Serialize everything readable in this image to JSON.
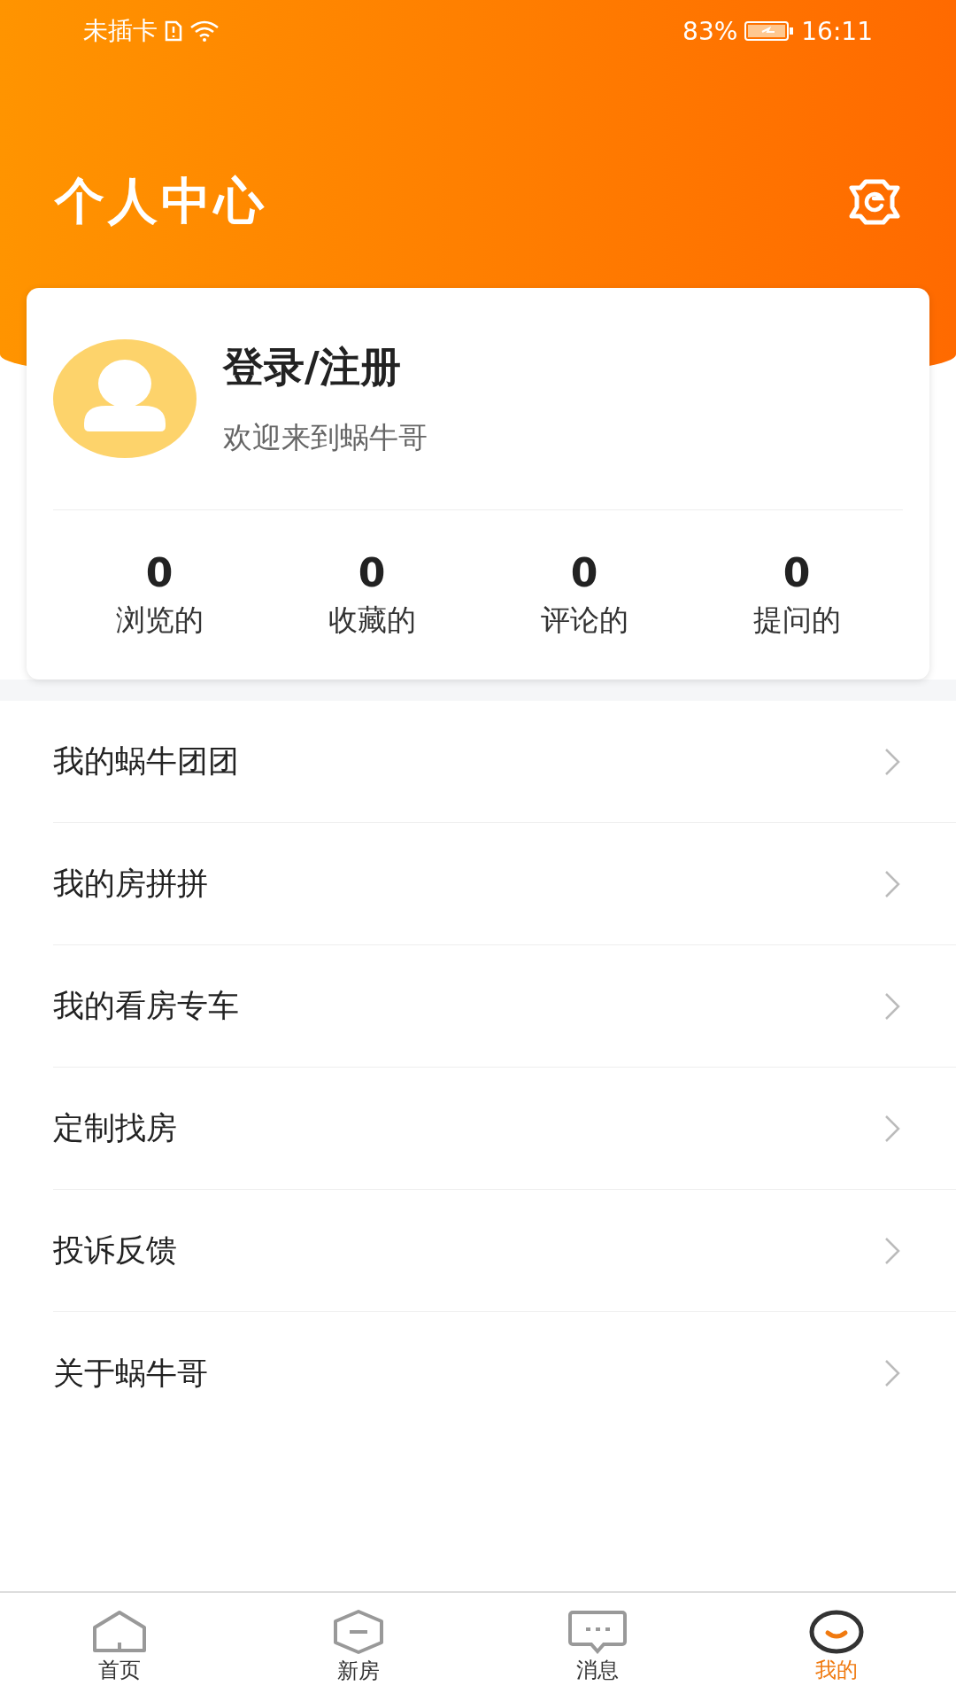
{
  "status_bar": {
    "carrier": "未插卡",
    "battery": "83%",
    "time": "16:11"
  },
  "header": {
    "title": "个人中心"
  },
  "profile": {
    "name": "登录/注册",
    "subtitle": "欢迎来到蜗牛哥"
  },
  "stats": [
    {
      "count": "0",
      "label": "浏览的"
    },
    {
      "count": "0",
      "label": "收藏的"
    },
    {
      "count": "0",
      "label": "评论的"
    },
    {
      "count": "0",
      "label": "提问的"
    }
  ],
  "menu": [
    {
      "label": "我的蜗牛团团"
    },
    {
      "label": "我的房拼拼"
    },
    {
      "label": "我的看房专车"
    },
    {
      "label": "定制找房"
    },
    {
      "label": "投诉反馈"
    },
    {
      "label": "关于蜗牛哥"
    }
  ],
  "tab_bar": [
    {
      "kind": "home",
      "label": "首页",
      "selected": false
    },
    {
      "kind": "hexagon",
      "label": "新房",
      "selected": false
    },
    {
      "kind": "message",
      "label": "消息",
      "selected": false
    },
    {
      "kind": "smile",
      "label": "我的",
      "selected": true
    }
  ]
}
